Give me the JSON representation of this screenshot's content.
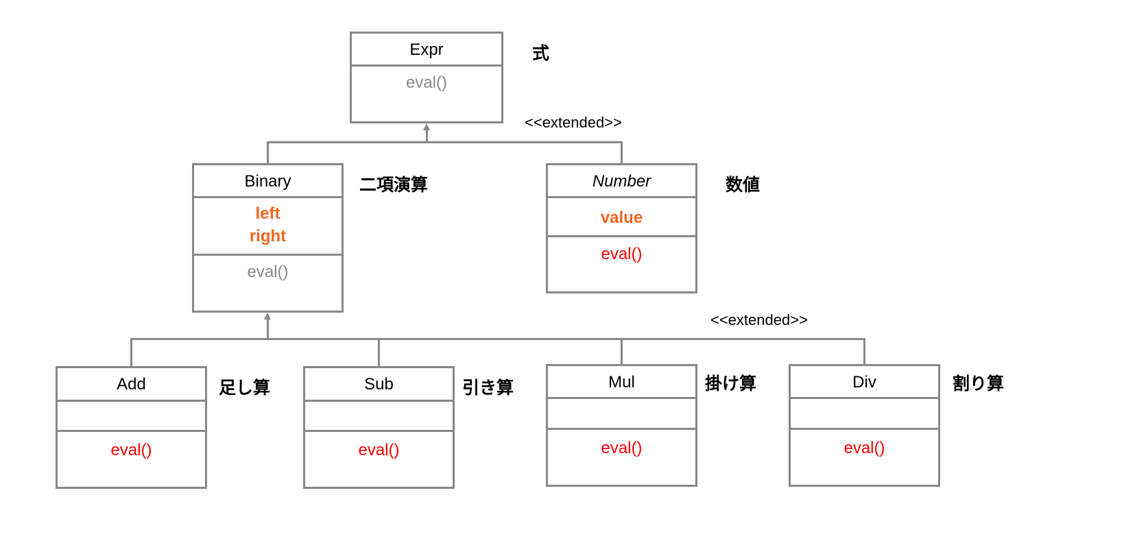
{
  "colors": {
    "border": "#888888",
    "attribute": "#f26522",
    "implemented_method": "#ff0000",
    "abstract_method": "#888888"
  },
  "stereotypes": [
    "<<extended>>",
    "<<extended>>"
  ],
  "classes": {
    "expr": {
      "name": "Expr",
      "label": "式",
      "methods": [
        "eval()"
      ]
    },
    "binary": {
      "name": "Binary",
      "label": "二項演算",
      "attributes": [
        "left",
        "right"
      ],
      "methods": [
        "eval()"
      ]
    },
    "number": {
      "name": "Number",
      "label": "数値",
      "attributes": [
        "value"
      ],
      "methods": [
        "eval()"
      ]
    },
    "add": {
      "name": "Add",
      "label": "足し算",
      "methods": [
        "eval()"
      ]
    },
    "sub": {
      "name": "Sub",
      "label": "引き算",
      "methods": [
        "eval()"
      ]
    },
    "mul": {
      "name": "Mul",
      "label": "掛け算",
      "methods": [
        "eval()"
      ]
    },
    "div": {
      "name": "Div",
      "label": "割り算",
      "methods": [
        "eval()"
      ]
    }
  }
}
